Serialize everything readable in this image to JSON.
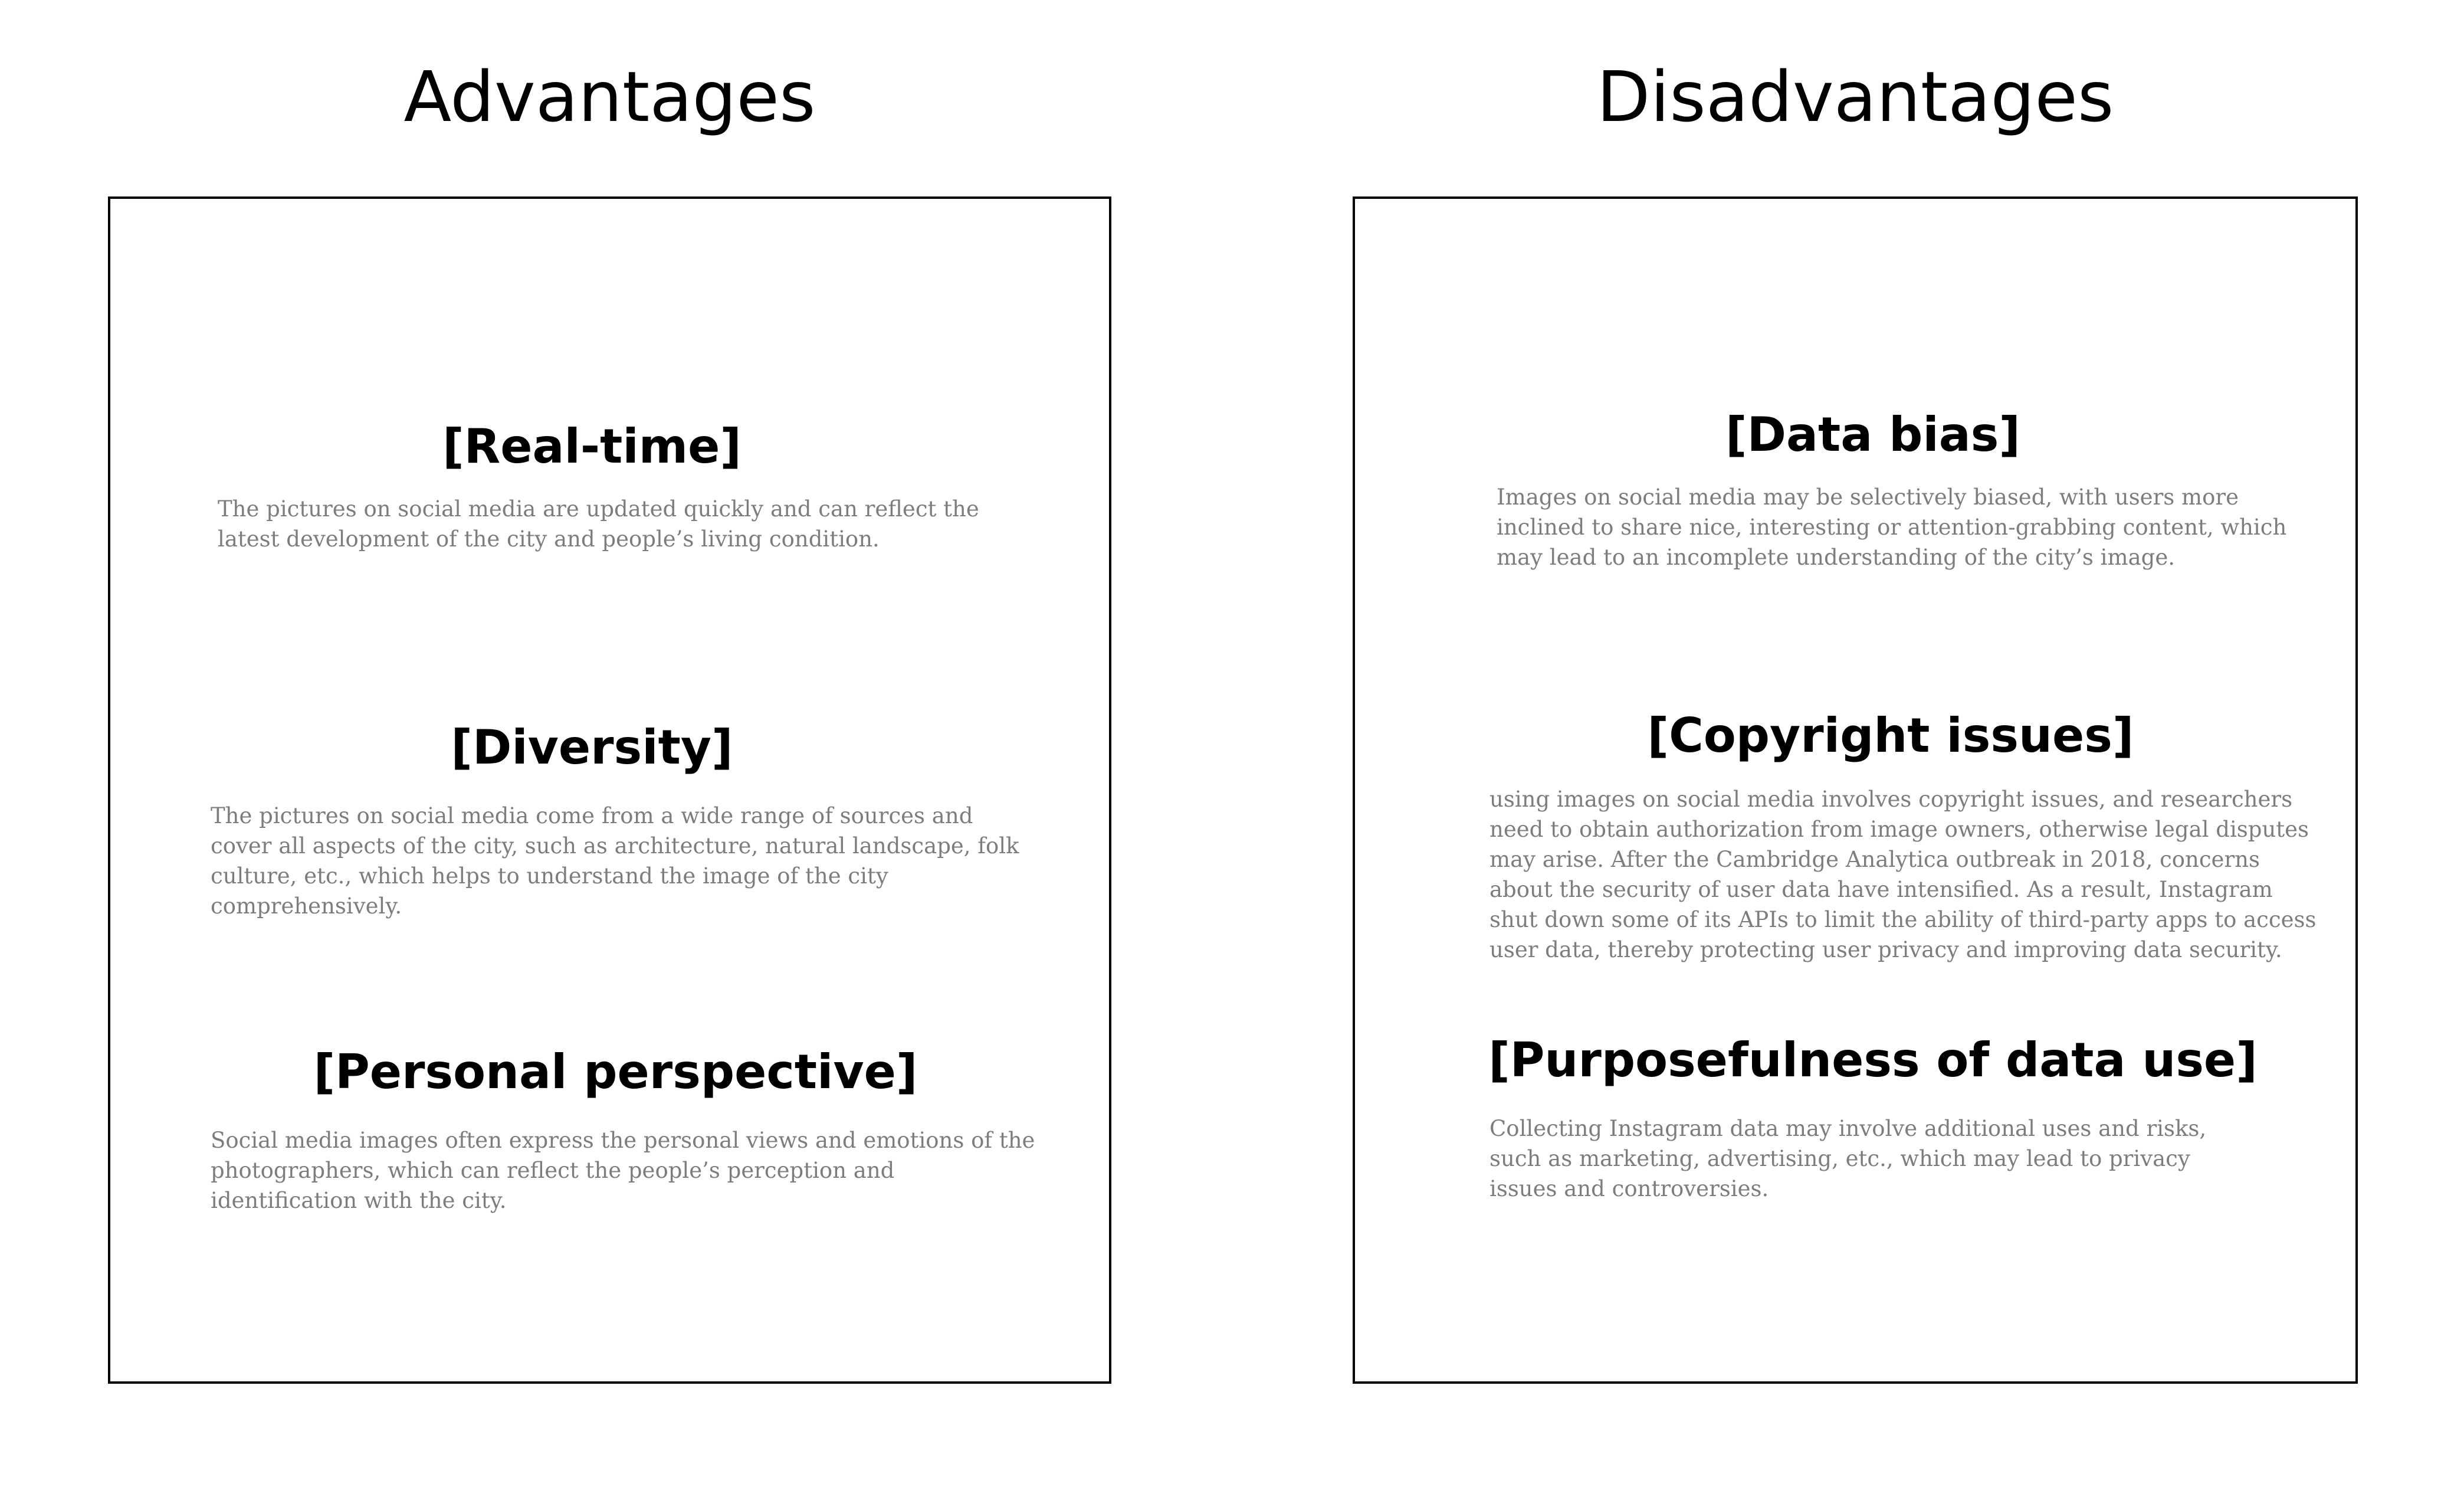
{
  "advantages": {
    "title": "Advantages",
    "items": [
      {
        "heading": "[Real-time]",
        "text": "The pictures on social media are updated quickly and can reflect the latest development of the city and people’s living condition."
      },
      {
        "heading": "[Diversity]",
        "text": "The pictures on social media come from a wide range of sources and cover all aspects of the city, such as architecture, natural landscape, folk culture, etc., which helps to understand the image of the city comprehensively."
      },
      {
        "heading": "[Personal perspective]",
        "text": "Social media images often express the personal views and emotions of the photographers, which can reflect the people’s perception and identification with the city."
      }
    ]
  },
  "disadvantages": {
    "title": "Disadvantages",
    "items": [
      {
        "heading": "[Data bias]",
        "text": "Images on social media may be selectively biased, with users more inclined to share nice, interesting or attention-grabbing content, which may lead to an incomplete understanding of the city’s image."
      },
      {
        "heading": "[Copyright issues]",
        "text": "using images on social media involves copyright issues, and researchers need to obtain authorization from image owners, otherwise legal disputes may arise. After the Cambridge Analytica outbreak in 2018, concerns about the security of user data have intensified. As a result, Instagram shut down some of its APIs to limit the ability of third-party apps to access user data, thereby protecting user privacy and improving data security."
      },
      {
        "heading": "[Purposefulness of data use]",
        "text": "Collecting Instagram data may involve additional uses and risks, such as marketing, advertising, etc., which may lead to privacy issues and controversies."
      }
    ]
  }
}
